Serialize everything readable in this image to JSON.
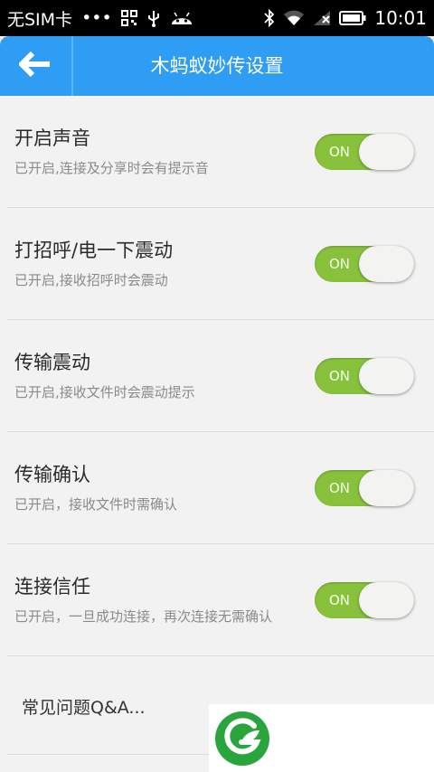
{
  "status_bar": {
    "carrier": "无SIM卡",
    "dots": "•••",
    "time": "10:01"
  },
  "header": {
    "title": "木蚂蚁妙传设置",
    "color": "#2f9df4"
  },
  "settings": [
    {
      "title": "开启声音",
      "description": "已开启,连接及分享时会有提示音",
      "toggle_label": "ON",
      "enabled": true
    },
    {
      "title": "打招呼/电一下震动",
      "description": "已开启,接收招呼时会震动",
      "toggle_label": "ON",
      "enabled": true
    },
    {
      "title": "传输震动",
      "description": "已开启,接收文件时会震动提示",
      "toggle_label": "ON",
      "enabled": true
    },
    {
      "title": "传输确认",
      "description": "已开启，接收文件时需确认",
      "toggle_label": "ON",
      "enabled": true
    },
    {
      "title": "连接信任",
      "description": "已开启，一旦成功连接，再次连接无需确认",
      "toggle_label": "ON",
      "enabled": true
    }
  ],
  "faq": {
    "label": "常见问题Q&A..."
  },
  "colors": {
    "toggle_on": "#88c23c",
    "logo_green": "#2aa43c"
  }
}
